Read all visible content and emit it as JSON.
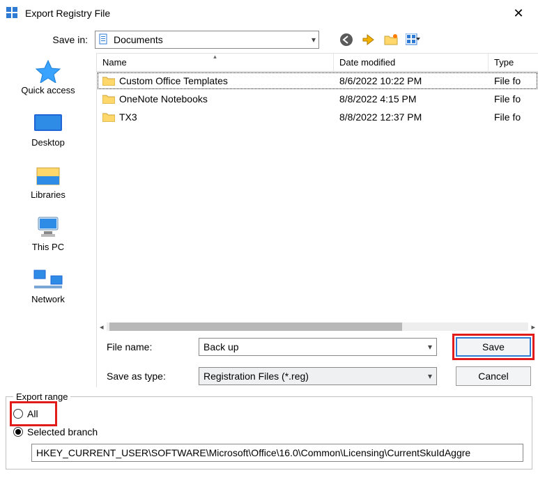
{
  "title": "Export Registry File",
  "save_in": {
    "label": "Save in:",
    "value": "Documents"
  },
  "columns": {
    "name": "Name",
    "date": "Date modified",
    "type": "Type"
  },
  "nav": {
    "quick_access": "Quick access",
    "desktop": "Desktop",
    "libraries": "Libraries",
    "this_pc": "This PC",
    "network": "Network"
  },
  "files": [
    {
      "name": "Custom Office Templates",
      "date": "8/6/2022 10:22 PM",
      "type": "File fo",
      "selected": true
    },
    {
      "name": "OneNote Notebooks",
      "date": "8/8/2022 4:15 PM",
      "type": "File fo",
      "selected": false
    },
    {
      "name": "TX3",
      "date": "8/8/2022 12:37 PM",
      "type": "File fo",
      "selected": false
    }
  ],
  "filename": {
    "label": "File name:",
    "value": "Back up"
  },
  "filetype": {
    "label": "Save as type:",
    "value": "Registration Files (*.reg)"
  },
  "buttons": {
    "save": "Save",
    "cancel": "Cancel"
  },
  "export_range": {
    "legend": "Export range",
    "all": "All",
    "selected_branch": "Selected branch",
    "branch_path": "HKEY_CURRENT_USER\\SOFTWARE\\Microsoft\\Office\\16.0\\Common\\Licensing\\CurrentSkuIdAggre"
  }
}
